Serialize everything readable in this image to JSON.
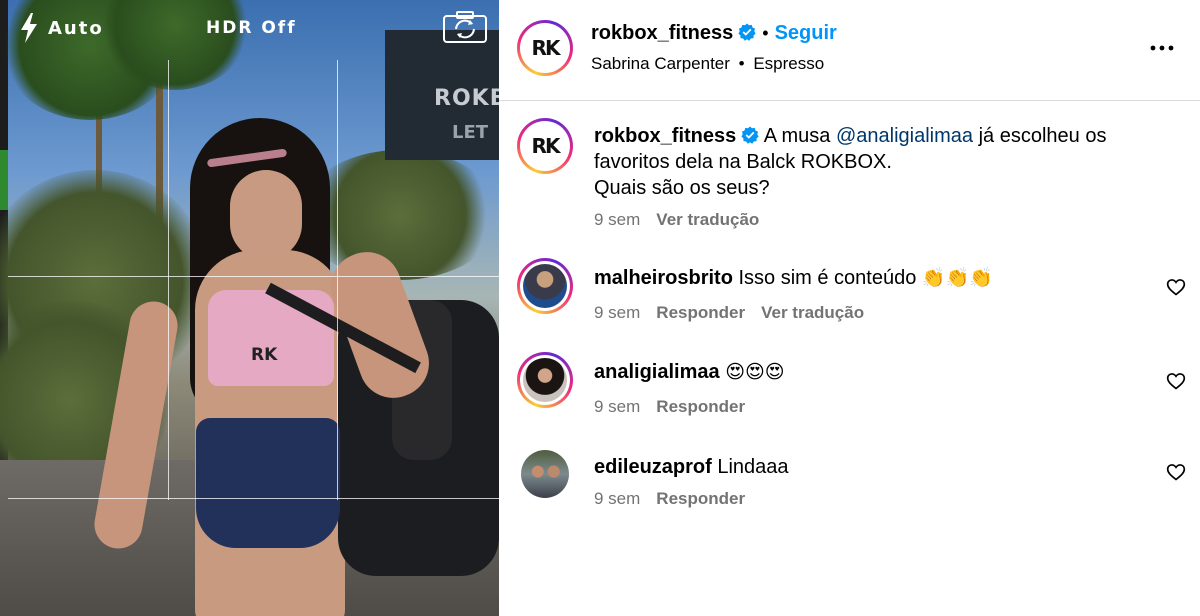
{
  "camera": {
    "flash_mode": "Auto",
    "hdr_label": "HDR Off",
    "flash_icon": "lightning-bolt-icon",
    "flip_icon": "camera-flip-icon"
  },
  "media": {
    "sign_text": "ROKB",
    "sign_text_2": "LET",
    "shirt_logo": "RK"
  },
  "post_header": {
    "username": "rokbox_fitness",
    "separator": "•",
    "follow_label": "Seguir",
    "audio_artist": "Sabrina Carpenter",
    "audio_separator": "•",
    "audio_track": "Espresso",
    "avatar_logo": "RK"
  },
  "caption": {
    "username": "rokbox_fitness",
    "text_before": "A musa ",
    "mention": "@analigialimaa",
    "text_after": " já escolheu os favoritos dela na Balck ROKBOX.",
    "line2": "Quais são os seus?",
    "time": "9 sem",
    "translate": "Ver tradução",
    "avatar_logo": "RK"
  },
  "comments": [
    {
      "username": "malheirosbrito",
      "text": "Isso sim é conteúdo",
      "emoji": "👏👏👏",
      "time": "9 sem",
      "reply": "Responder",
      "translate": "Ver tradução"
    },
    {
      "username": "analigialimaa",
      "text": "",
      "emoji": "😍😍😍",
      "time": "9 sem",
      "reply": "Responder"
    },
    {
      "username": "edileuzaprof",
      "text": "Lindaaa",
      "emoji": "",
      "time": "9 sem",
      "reply": "Responder"
    }
  ],
  "colors": {
    "accent": "#0095f6",
    "mention": "#00376b",
    "meta_grey": "#737373",
    "border": "#dbdbdb"
  }
}
